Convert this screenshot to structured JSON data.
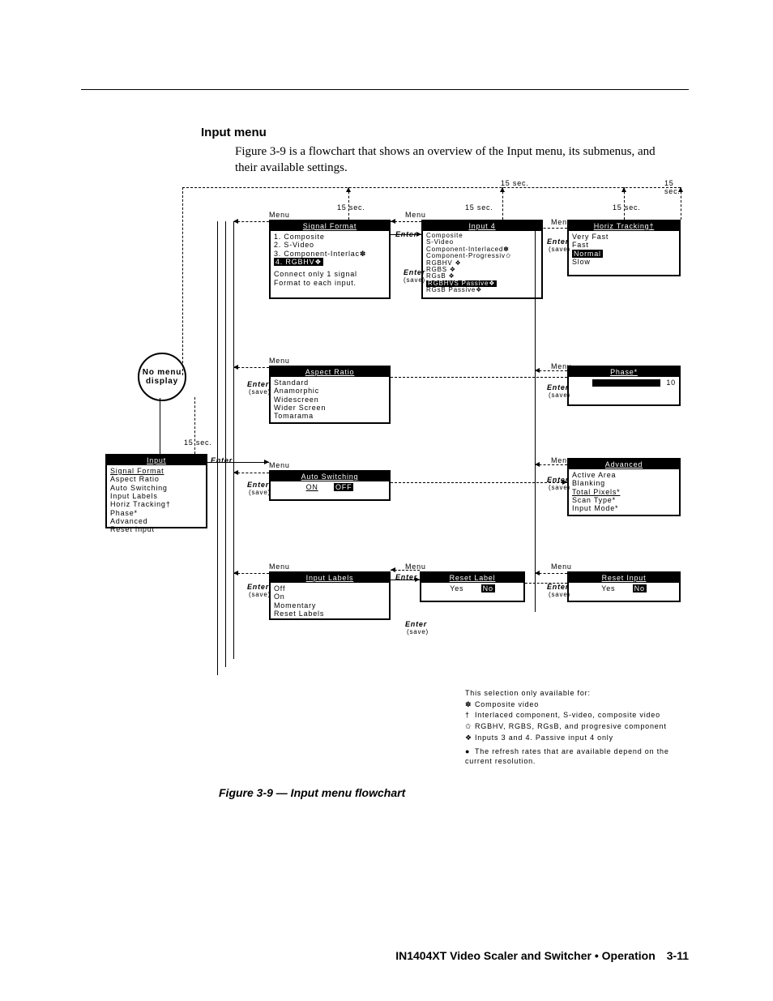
{
  "heading": "Input menu",
  "intro": "Figure 3-9 is a flowchart that shows an overview of the Input menu, its submenus, and their available settings.",
  "caption": "Figure 3-9 — Input menu flowchart",
  "footer_left": "IN1404XT Video Scaler and Switcher • Operation",
  "footer_page": "3-11",
  "nomenu": "No menu display",
  "timeouts": {
    "t15": "15 sec."
  },
  "labels": {
    "menu": "Menu",
    "enter": "Enter",
    "save": "(save)"
  },
  "input_box": {
    "title": "Input",
    "items": [
      "Signal Format",
      "Aspect Ratio",
      "Auto Switching",
      "Input Labels",
      "Horiz Tracking†",
      "Phase*",
      "Advanced",
      "Reset Input"
    ]
  },
  "signal_format": {
    "title": "Signal Format",
    "items": [
      "1. Composite",
      "2. S-Video",
      "3. Component-Interlac✽",
      "4. RGBHV❖"
    ],
    "note": "Connect only 1 signal Format to each input."
  },
  "input4": {
    "title": "Input 4",
    "items": [
      "Composite",
      "S-Video",
      "Component-Interlaced",
      "Component-Progressiv",
      "RGBHV ❖",
      "RGBS ❖",
      "RGsB ❖",
      "RGBHVS Passive❖",
      "RGsB Passive❖"
    ],
    "marks": [
      "",
      "",
      "✽",
      "✩",
      "",
      "",
      "",
      "",
      ""
    ]
  },
  "aspect": {
    "title": "Aspect Ratio",
    "items": [
      "Standard",
      "Anamorphic",
      "Widescreen",
      "Wider Screen",
      "Tomarama"
    ]
  },
  "autosw": {
    "title": "Auto Switching",
    "on": "ON",
    "off": "OFF"
  },
  "inlabels": {
    "title": "Input Labels",
    "items": [
      "Off",
      "On",
      "Momentary",
      "Reset Labels"
    ]
  },
  "resetlabel": {
    "title": "Reset Label",
    "yes": "Yes",
    "no": "No"
  },
  "horiz": {
    "title": "Horiz Tracking†",
    "items": [
      "Very Fast",
      "Fast",
      "Normal",
      "Slow"
    ]
  },
  "phase": {
    "title": "Phase*",
    "value": "10"
  },
  "advanced": {
    "title": "Advanced",
    "items": [
      "Active Area",
      "Blanking",
      "Total Pixels*",
      "Scan Type*",
      "Input Mode*"
    ]
  },
  "resetinput": {
    "title": "Reset Input",
    "yes": "Yes",
    "no": "No"
  },
  "footnotes": {
    "lead": "This selection only available for:",
    "f1": "Composite video",
    "f2": "Interlaced component, S-video, composite video",
    "f3": "RGBHV, RGBS, RGsB, and progresive component",
    "f4": "Inputs 3 and 4.  Passive input 4 only",
    "f5": "The refresh rates that are available depend on the current resolution."
  }
}
